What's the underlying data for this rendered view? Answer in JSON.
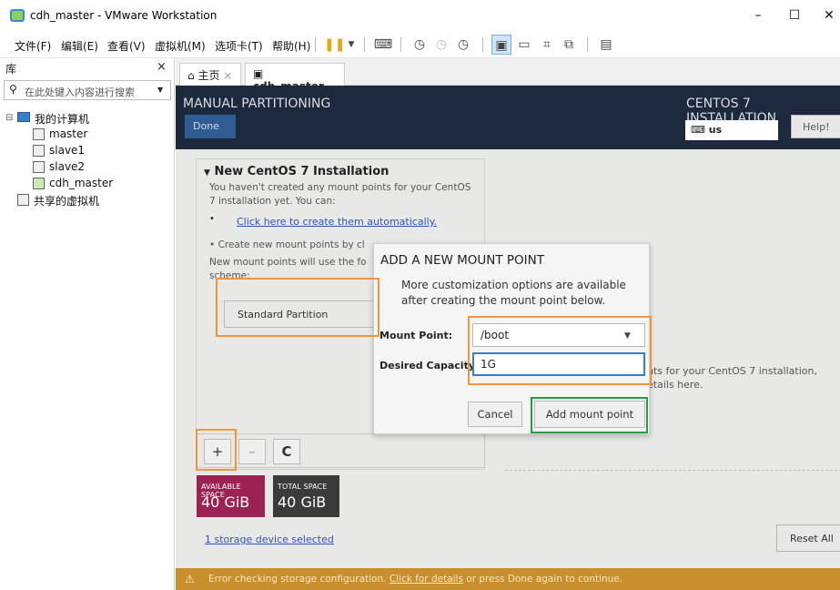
{
  "window": {
    "title": "cdh_master - VMware Workstation",
    "controls": [
      "–",
      "☐",
      "✕"
    ]
  },
  "menu": {
    "items": [
      "文件(F)",
      "编辑(E)",
      "查看(V)",
      "虚拟机(M)",
      "选项卡(T)",
      "帮助(H)"
    ]
  },
  "library": {
    "title": "库",
    "close": "×",
    "search_placeholder": "在此处键入内容进行搜索",
    "tree": {
      "root": "我的计算机",
      "vms": [
        "master",
        "slave1",
        "slave2",
        "cdh_master"
      ],
      "shared": "共享的虚拟机"
    }
  },
  "tabs": [
    {
      "label": "主页",
      "close": "×"
    },
    {
      "label": "cdh_master",
      "close": "×"
    }
  ],
  "installer": {
    "header_title": "MANUAL PARTITIONING",
    "header_right": "CENTOS 7 INSTALLATION",
    "done_label": "Done",
    "keyboard": "us",
    "help_label": "Help!",
    "left_pane": {
      "title": "New CentOS 7 Installation",
      "intro": [
        "You haven't created any mount points for your CentOS",
        "7 installation yet.  You can:"
      ],
      "auto_link": "Click here to create them automatically.",
      "bullet2": "Create new mount points by cl",
      "note": [
        "New mount points will use the fo",
        "scheme:"
      ],
      "scheme_value": "Standard Partition"
    },
    "controls": {
      "add": "+",
      "remove": "–",
      "refresh": "C"
    },
    "available": {
      "label": "AVAILABLE SPACE",
      "value": "40 GiB"
    },
    "total": {
      "label": "TOTAL SPACE",
      "value": "40 GiB"
    },
    "storage_link": "1 storage device selected",
    "reset_label": "Reset All",
    "right_info": [
      "nts for your CentOS 7 installation,",
      "etails here."
    ],
    "error": {
      "prefix": "Error checking storage configuration.",
      "link": "Click for details",
      "suffix": " or press Done again to continue."
    },
    "colors": {
      "available": "#9b2253",
      "total": "#3b3b3b",
      "error_bar": "#c98f2c",
      "header": "#1d2a3d"
    }
  },
  "dialog": {
    "title": "ADD A NEW MOUNT POINT",
    "desc": [
      "More customization options are available",
      "after creating the mount point below."
    ],
    "mount_point_label": "Mount Point:",
    "mount_point_value": "/boot",
    "capacity_label": "Desired Capacity:",
    "capacity_value": "1G",
    "cancel_label": "Cancel",
    "add_label": "Add mount point"
  }
}
